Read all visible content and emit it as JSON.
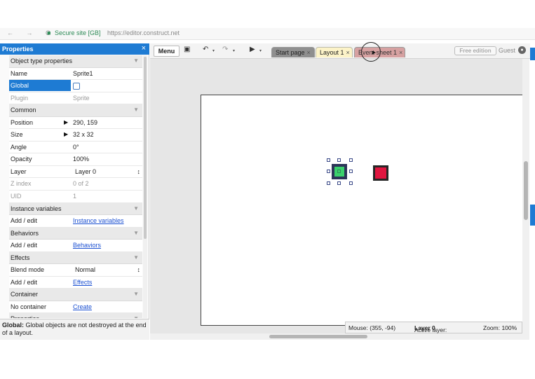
{
  "browser": {
    "nav_icons": "← → C",
    "secure_icon": "lock-icon",
    "secure_label": "Secure site [GB]",
    "url": "https://editor.construct.net"
  },
  "properties": {
    "title": "Properties",
    "close_icon": "×",
    "rows": [
      {
        "kind": "cat",
        "label": "Object type properties"
      },
      {
        "kind": "row",
        "key": "Name",
        "value": "Sprite1"
      },
      {
        "kind": "check",
        "key": "Global"
      },
      {
        "kind": "dis",
        "key": "Plugin",
        "value": "Sprite"
      },
      {
        "kind": "cat",
        "label": "Common"
      },
      {
        "kind": "expand",
        "key": "Position",
        "value": "290, 159"
      },
      {
        "kind": "expand",
        "key": "Size",
        "value": "32 x 32"
      },
      {
        "kind": "row",
        "key": "Angle",
        "value": "0°"
      },
      {
        "kind": "row",
        "key": "Opacity",
        "value": "100%"
      },
      {
        "kind": "select",
        "key": "Layer",
        "value": "Layer 0"
      },
      {
        "kind": "dis",
        "key": "Z index",
        "value": "0 of 2"
      },
      {
        "kind": "dis",
        "key": "UID",
        "value": "1"
      },
      {
        "kind": "cat",
        "label": "Instance variables"
      },
      {
        "kind": "link",
        "key": "Add / edit",
        "value": "Instance variables"
      },
      {
        "kind": "cat",
        "label": "Behaviors"
      },
      {
        "kind": "link",
        "key": "Add / edit",
        "value": "Behaviors"
      },
      {
        "kind": "cat",
        "label": "Effects"
      },
      {
        "kind": "select",
        "key": "Blend mode",
        "value": "Normal"
      },
      {
        "kind": "link",
        "key": "Add / edit",
        "value": "Effects"
      },
      {
        "kind": "cat",
        "label": "Container"
      },
      {
        "kind": "link",
        "key": "No container",
        "value": "Create"
      },
      {
        "kind": "cat",
        "label": "Properties"
      }
    ],
    "help_bold": "Global:",
    "help_text": " Global objects are not destroyed at the end of a layout."
  },
  "toolbar": {
    "menu_label": "Menu",
    "save_icon": "💾",
    "undo_icon": "↶",
    "redo_icon": "↷",
    "play_icon": "▶",
    "dropdown_icon": "▾",
    "tabs": [
      {
        "label": "Start page",
        "close": "×"
      },
      {
        "label": "Layout 1",
        "close": "×"
      },
      {
        "label": "Event sheet 1",
        "close": "×"
      }
    ],
    "free_edition": "Free edition",
    "guest": "Guest",
    "guest_icon": "👤"
  },
  "status": {
    "mouse_label": "Mouse: (355, -94)",
    "active_layer_label": "Active layer: ",
    "active_layer_value": "Layer 0",
    "zoom_label": "Zoom: 100%"
  },
  "colors": {
    "accent": "#1e7bd3",
    "sprite1_fill": "#3bd16c",
    "sprite2_fill": "#e01640"
  }
}
